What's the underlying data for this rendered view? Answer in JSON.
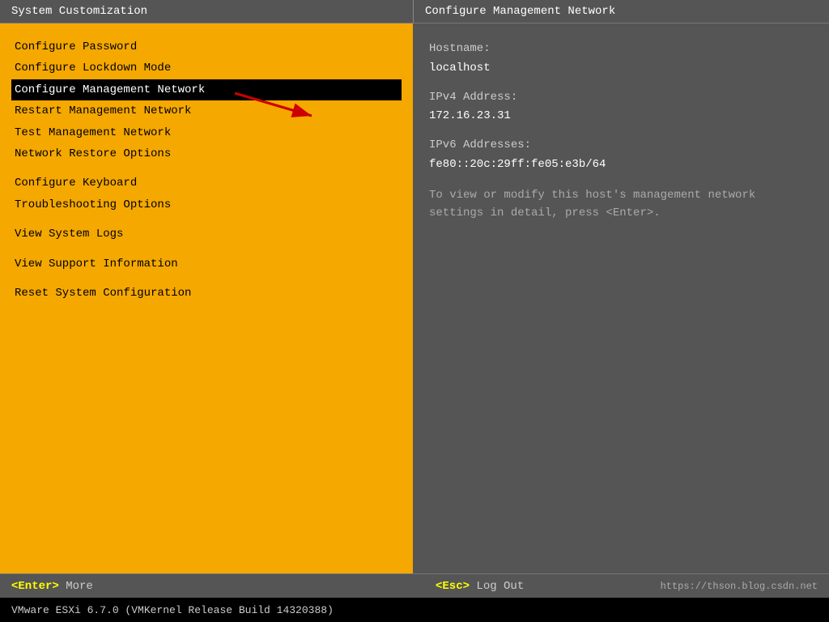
{
  "left_panel": {
    "header": "System Customization",
    "menu_items": [
      {
        "id": "configure-password",
        "label": "Configure Password",
        "selected": false,
        "spacer_before": false
      },
      {
        "id": "configure-lockdown",
        "label": "Configure Lockdown Mode",
        "selected": false,
        "spacer_before": false
      },
      {
        "id": "configure-management-network",
        "label": "Configure Management Network",
        "selected": true,
        "spacer_before": false
      },
      {
        "id": "restart-management-network",
        "label": "Restart Management Network",
        "selected": false,
        "spacer_before": false
      },
      {
        "id": "test-management-network",
        "label": "Test Management Network",
        "selected": false,
        "spacer_before": false
      },
      {
        "id": "network-restore-options",
        "label": "Network Restore Options",
        "selected": false,
        "spacer_before": false
      },
      {
        "id": "configure-keyboard",
        "label": "Configure Keyboard",
        "selected": false,
        "spacer_before": true
      },
      {
        "id": "troubleshooting-options",
        "label": "Troubleshooting Options",
        "selected": false,
        "spacer_before": false
      },
      {
        "id": "view-system-logs",
        "label": "View System Logs",
        "selected": false,
        "spacer_before": true
      },
      {
        "id": "view-support-information",
        "label": "View Support Information",
        "selected": false,
        "spacer_before": true
      },
      {
        "id": "reset-system-configuration",
        "label": "Reset System Configuration",
        "selected": false,
        "spacer_before": true
      }
    ]
  },
  "right_panel": {
    "header": "Configure Management Network",
    "hostname_label": "Hostname:",
    "hostname_value": "localhost",
    "ipv4_label": "IPv4 Address:",
    "ipv4_value": "172.16.23.31",
    "ipv6_label": "IPv6 Addresses:",
    "ipv6_value": "fe80::20c:29ff:fe05:e3b/64",
    "description": "To view or modify this host's management network settings in detail, press <Enter>."
  },
  "bottom_bar": {
    "enter_label": "<Enter>",
    "more_label": "More",
    "esc_label": "<Esc>",
    "logout_label": "Log Out",
    "url": "https://thson.blog.csdn.net"
  },
  "footer": {
    "text": "VMware ESXi 6.7.0 (VMKernel Release Build 14320388)"
  }
}
